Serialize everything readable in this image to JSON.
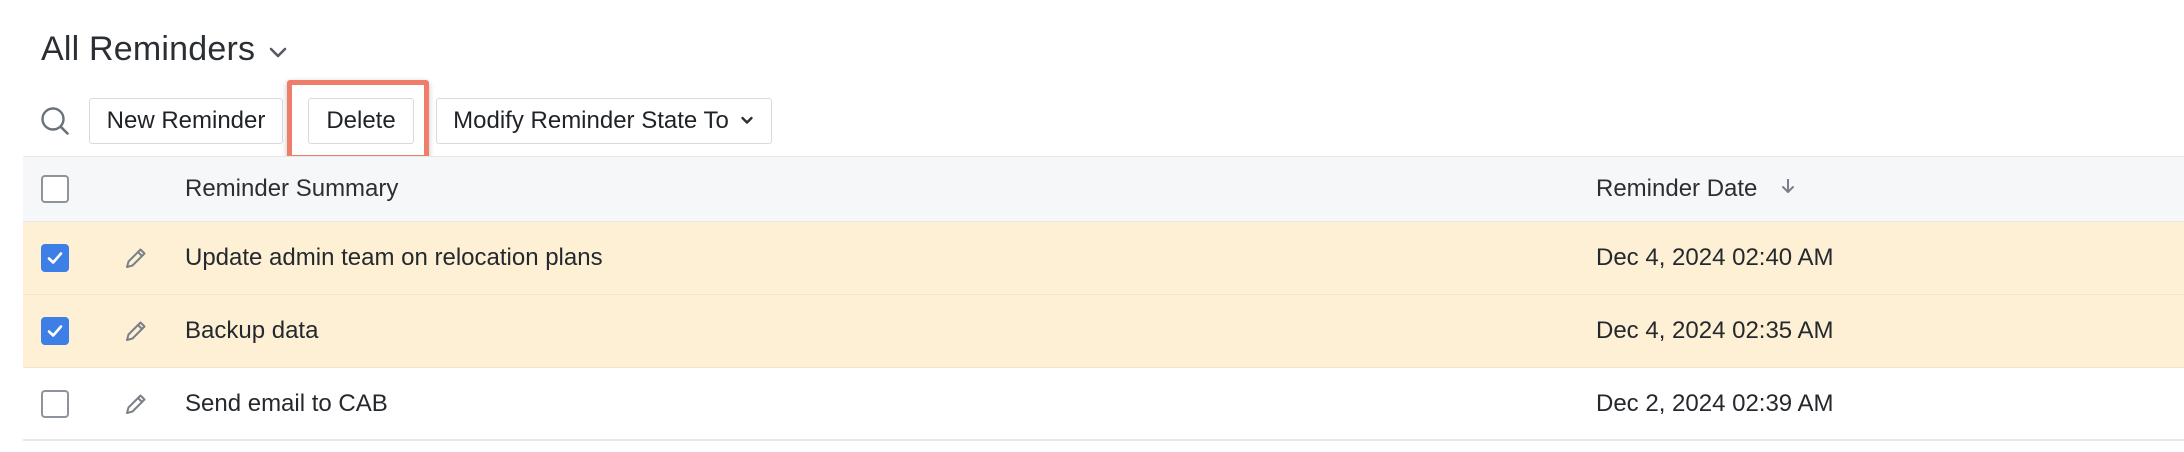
{
  "header": {
    "title": "All Reminders",
    "title_menu_icon": "chevron-down-icon"
  },
  "toolbar": {
    "search_icon": "search-icon",
    "new_label": "New Reminder",
    "delete_label": "Delete",
    "modify_label": "Modify Reminder State To",
    "modify_icon": "chevron-down-icon"
  },
  "table": {
    "columns": {
      "summary": "Reminder Summary",
      "date": "Reminder Date",
      "date_sort_icon": "arrow-down-icon"
    },
    "rows": [
      {
        "summary": "Update admin team on relocation plans",
        "date": "Dec 4, 2024 02:40 AM",
        "selected": true
      },
      {
        "summary": "Backup data",
        "date": "Dec 4, 2024 02:35 AM",
        "selected": true
      },
      {
        "summary": "Send email to CAB",
        "date": "Dec 2, 2024 02:39 AM",
        "selected": false
      }
    ]
  },
  "colors": {
    "accent": "#3d7fe6",
    "selected_row": "#fdf0d5",
    "highlight": "#ee7e6a"
  }
}
